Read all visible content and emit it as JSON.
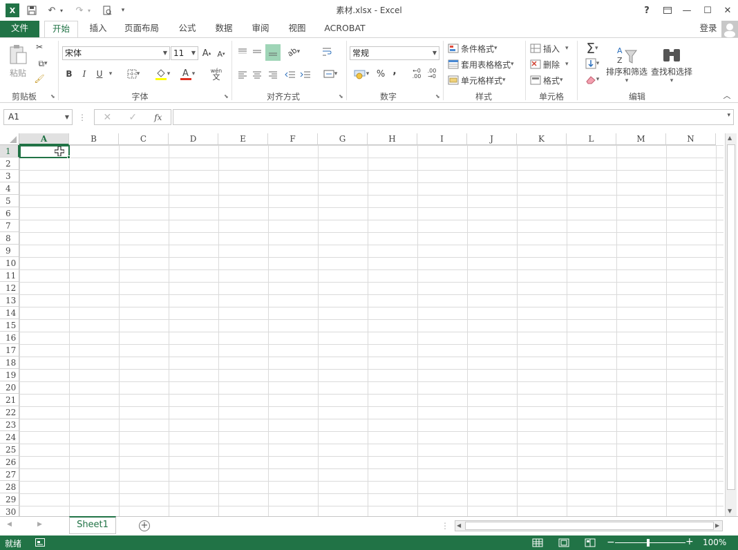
{
  "window": {
    "title": "素材.xlsx - Excel"
  },
  "titlebar": {
    "help": "?",
    "minimize": "—",
    "maximize": "☐",
    "close": "✕"
  },
  "tabs": [
    {
      "label": "文件"
    },
    {
      "label": "开始"
    },
    {
      "label": "插入"
    },
    {
      "label": "页面布局"
    },
    {
      "label": "公式"
    },
    {
      "label": "数据"
    },
    {
      "label": "审阅"
    },
    {
      "label": "视图"
    },
    {
      "label": "ACROBAT"
    }
  ],
  "signin": "登录",
  "ribbon": {
    "clipboard": {
      "label": "剪贴板",
      "paste": "粘贴"
    },
    "font": {
      "label": "字体",
      "name": "宋体",
      "size": "11",
      "bold": "B",
      "italic": "I",
      "underline": "U",
      "grow": "A",
      "shrink": "A",
      "wen": "wén\n文"
    },
    "alignment": {
      "label": "对齐方式"
    },
    "number": {
      "label": "数字",
      "format": "常规",
      "percent": "%",
      "comma": ","
    },
    "styles": {
      "label": "样式",
      "conditional": "条件格式",
      "table": "套用表格格式",
      "cell": "单元格样式"
    },
    "cells": {
      "label": "单元格",
      "insert": "插入",
      "delete": "删除",
      "format": "格式"
    },
    "editing": {
      "label": "编辑",
      "sort": "排序和筛选",
      "find": "查找和选择"
    }
  },
  "formula": {
    "namebox": "A1",
    "fx": "fx",
    "value": ""
  },
  "grid": {
    "columns": [
      "A",
      "B",
      "C",
      "D",
      "E",
      "F",
      "G",
      "H",
      "I",
      "J",
      "K",
      "L",
      "M",
      "N"
    ],
    "rows": [
      "1",
      "2",
      "3",
      "4",
      "5",
      "6",
      "7",
      "8",
      "9",
      "10",
      "11",
      "12",
      "13",
      "14",
      "15",
      "16",
      "17",
      "18",
      "19",
      "20",
      "21",
      "22",
      "23",
      "24",
      "25",
      "26",
      "27",
      "28",
      "29",
      "30"
    ],
    "selected_cell": "A1"
  },
  "sheets": [
    {
      "name": "Sheet1"
    }
  ],
  "status": {
    "ready": "就绪",
    "zoom": "100%",
    "minus": "−",
    "plus": "+"
  },
  "colors": {
    "accent": "#217346"
  }
}
